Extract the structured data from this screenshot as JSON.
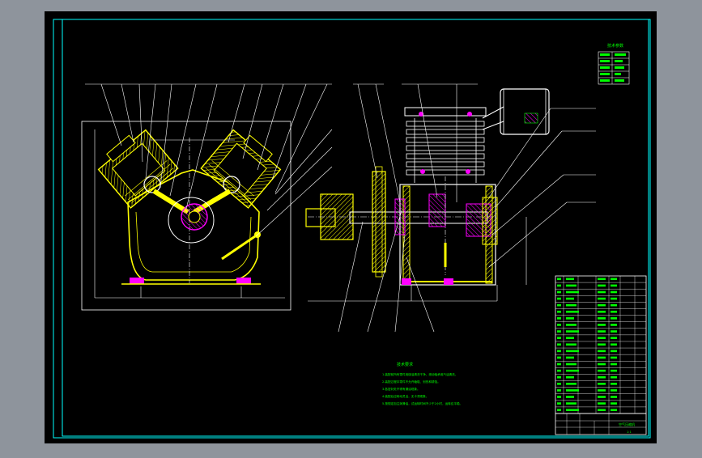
{
  "drawing": {
    "tech_title": "技术要求",
    "tech_notes": [
      "1.装配前所有零件用煤油清洗干净，滚动轴承用汽油清洗。",
      "2.装配过程中零件不允许磕碰、划伤和锈蚀。",
      "3.各密封处不得有漏油现象。",
      "4.装配后应转动灵活，无卡滞现象。",
      "5.按规定加注润滑油，试运转时间不少于2小时，运转应平稳。"
    ],
    "spec_title": "技术参数",
    "title_name": "空气压缩机",
    "title_scale": "1:1",
    "colors": {
      "background": "#000000",
      "border": "#00ffff",
      "part": "#ffff00",
      "section": "#ff00ff",
      "annotation": "#00ff00",
      "outline": "#ffffff"
    }
  }
}
